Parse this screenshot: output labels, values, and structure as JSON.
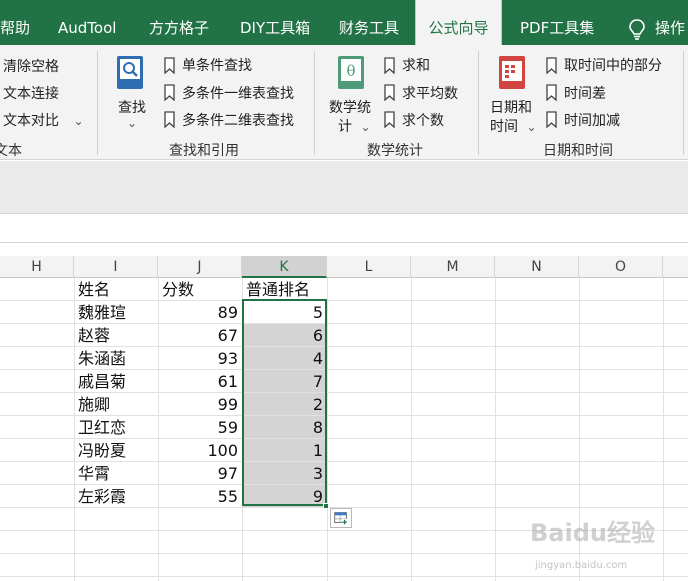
{
  "tabs": [
    {
      "label": "帮助"
    },
    {
      "label": "AudTool"
    },
    {
      "label": "方方格子"
    },
    {
      "label": "DIY工具箱"
    },
    {
      "label": "财务工具"
    },
    {
      "label": "公式向导"
    },
    {
      "label": "PDF工具集"
    },
    {
      "label": "操作"
    }
  ],
  "active_tab": "公式向导",
  "ribbon": {
    "text_group": {
      "items": [
        "清除空格",
        "文本连接",
        "文本对比"
      ],
      "label": "文本"
    },
    "lookup_group": {
      "big_button": "查找",
      "items": [
        "单条件查找",
        "多条件一维表查找",
        "多条件二维表查找"
      ],
      "label": "查找和引用"
    },
    "stats_group": {
      "big_button_line1": "数学统",
      "big_button_line2": "计",
      "items": [
        "求和",
        "求平均数",
        "求个数"
      ],
      "label": "数学统计"
    },
    "date_group": {
      "big_button_line1": "日期和",
      "big_button_line2": "时间",
      "items": [
        "取时间中的部分",
        "时间差",
        "时间加减"
      ],
      "label": "日期和时间"
    },
    "dropdown_glyph": "⌄"
  },
  "columns": [
    "H",
    "I",
    "J",
    "K",
    "L",
    "M",
    "N",
    "O"
  ],
  "selected_column": "K",
  "table": {
    "headers": [
      "姓名",
      "分数",
      "普通排名"
    ],
    "rows": [
      {
        "name": "魏雅瑄",
        "score": "89",
        "rank": "5"
      },
      {
        "name": "赵蓉",
        "score": "67",
        "rank": "6"
      },
      {
        "name": "朱涵菡",
        "score": "93",
        "rank": "4"
      },
      {
        "name": "戚昌菊",
        "score": "61",
        "rank": "7"
      },
      {
        "name": "施卿",
        "score": "99",
        "rank": "2"
      },
      {
        "name": "卫红恋",
        "score": "59",
        "rank": "8"
      },
      {
        "name": "冯盼夏",
        "score": "100",
        "rank": "1"
      },
      {
        "name": "华霄",
        "score": "97",
        "rank": "3"
      },
      {
        "name": "左彩霞",
        "score": "55",
        "rank": "9"
      }
    ]
  },
  "watermark": {
    "main": "Baidu经验",
    "sub": "jingyan.baidu.com"
  },
  "colors": {
    "accent": "#217346",
    "ribbon_bg": "#f3f3f3",
    "selection": "#d4d4d4"
  }
}
